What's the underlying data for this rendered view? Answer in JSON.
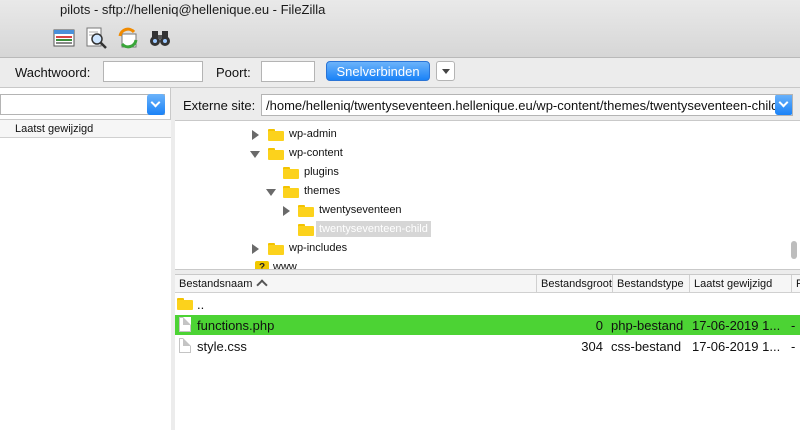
{
  "window": {
    "title": "pilots - sftp://helleniq@hellenique.eu - FileZilla"
  },
  "toolbar": {
    "icons": [
      "site-manager-icon",
      "search-icon",
      "refresh-sync-icon",
      "binoculars-icon"
    ]
  },
  "quickconnect": {
    "password_label": "Wachtwoord:",
    "password_value": "",
    "port_label": "Poort:",
    "port_value": "",
    "button_label": "Snelverbinden"
  },
  "local": {
    "path": "",
    "columns": [
      "Laatst gewijzigd"
    ]
  },
  "remote": {
    "site_label": "Externe site:",
    "path": "/home/helleniq/twentyseventeen.hellenique.eu/wp-content/themes/twentyseventeen-child",
    "tree": [
      {
        "label": "wp-admin",
        "expander": "right",
        "icon": "folder"
      },
      {
        "label": "wp-content",
        "expander": "down",
        "icon": "folder"
      },
      {
        "label": "plugins",
        "expander": "none",
        "icon": "folder"
      },
      {
        "label": "themes",
        "expander": "down",
        "icon": "folder"
      },
      {
        "label": "twentyseventeen",
        "expander": "right",
        "icon": "folder"
      },
      {
        "label": "twentyseventeen-child",
        "expander": "none",
        "icon": "folder",
        "selected": true
      },
      {
        "label": "wp-includes",
        "expander": "right",
        "icon": "folder"
      },
      {
        "label": "www",
        "expander": "none",
        "icon": "question"
      }
    ],
    "columns": [
      "Bestandsnaam",
      "Bestandsgrootte",
      "Bestandstype",
      "Laatst gewijzigd",
      "R"
    ],
    "files": [
      {
        "name": "..",
        "size": "",
        "type": "",
        "modified": "",
        "extra": "",
        "icon": "folder"
      },
      {
        "name": "functions.php",
        "size": "0",
        "type": "php-bestand",
        "modified": "17-06-2019 1...",
        "extra": "-",
        "icon": "file",
        "selected": true
      },
      {
        "name": "style.css",
        "size": "304",
        "type": "css-bestand",
        "modified": "17-06-2019 1...",
        "extra": "-",
        "icon": "file"
      }
    ]
  },
  "colors": {
    "accent": "#1a82f7",
    "selection": "#4cd334",
    "folder": "#fcd21c"
  }
}
